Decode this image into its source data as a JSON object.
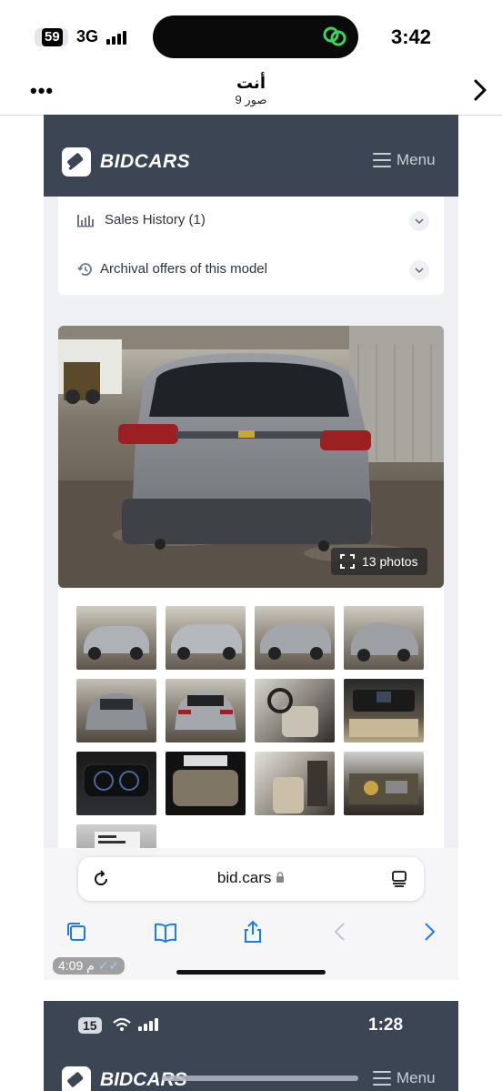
{
  "status_bar": {
    "battery": "59",
    "network": "3G",
    "time": "3:42"
  },
  "chat_header": {
    "more": "•••",
    "title": "أنت",
    "subtitle": "9 صور"
  },
  "site": {
    "brand": "BIDCARS",
    "menu_label": "Menu",
    "accordion": [
      {
        "label": "Sales History (1)",
        "icon": "bar-chart-icon"
      },
      {
        "label": "Archival offers of this model",
        "icon": "history-icon"
      }
    ],
    "photos_badge": "13 photos",
    "thumbnail_count": 13
  },
  "safari": {
    "url": "bid.cars",
    "timestamp": "4:09 م"
  },
  "second_shot": {
    "battery": "15",
    "time": "1:28",
    "brand": "BIDCARS",
    "menu_label": "Menu"
  },
  "colors": {
    "navbar": "#3b4553",
    "ios_blue": "#1a7cf4",
    "accent_green": "#3bd45a"
  }
}
